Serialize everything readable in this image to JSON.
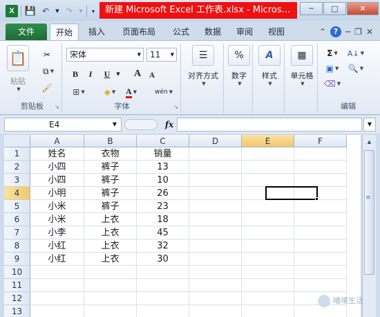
{
  "window": {
    "title": "新建 Microsoft Excel 工作表.xlsx - Micros...",
    "controls": [
      "─",
      "□",
      "✕"
    ]
  },
  "tabs": {
    "file": "文件",
    "items": [
      "开始",
      "插入",
      "页面布局",
      "公式",
      "数据",
      "审阅",
      "视图"
    ],
    "active": "开始"
  },
  "ribbon": {
    "clipboard": {
      "paste": "粘贴",
      "label": "剪贴板"
    },
    "font": {
      "name": "宋体",
      "size": "11",
      "bold": "B",
      "italic": "I",
      "underline": "U",
      "grow": "A",
      "shrink": "A",
      "fontcolor": "A",
      "phonetic": "wén",
      "label": "字体"
    },
    "alignment": {
      "label": "对齐方式"
    },
    "number": {
      "label": "数字",
      "icon": "%"
    },
    "styles": {
      "label": "样式"
    },
    "cells": {
      "label": "单元格"
    },
    "editing": {
      "label": "编辑",
      "sum": "Σ"
    }
  },
  "formula_bar": {
    "name_box": "E4",
    "fx": "fx",
    "content": ""
  },
  "sheet": {
    "columns": [
      "A",
      "B",
      "C",
      "D",
      "E",
      "F"
    ],
    "selected_column": "E",
    "rows": [
      "1",
      "2",
      "3",
      "4",
      "5",
      "6",
      "7",
      "8",
      "9",
      "10",
      "11",
      "12",
      "13"
    ],
    "selected_row": "4",
    "data": [
      [
        "姓名",
        "衣物",
        "销量"
      ],
      [
        "小四",
        "裤子",
        "13"
      ],
      [
        "小四",
        "裤子",
        "10"
      ],
      [
        "小明",
        "裤子",
        "26"
      ],
      [
        "小米",
        "裤子",
        "23"
      ],
      [
        "小米",
        "上衣",
        "18"
      ],
      [
        "小李",
        "上衣",
        "45"
      ],
      [
        "小红",
        "上衣",
        "32"
      ],
      [
        "小红",
        "上衣",
        "30"
      ]
    ]
  },
  "watermark": "嘻嗦生活"
}
